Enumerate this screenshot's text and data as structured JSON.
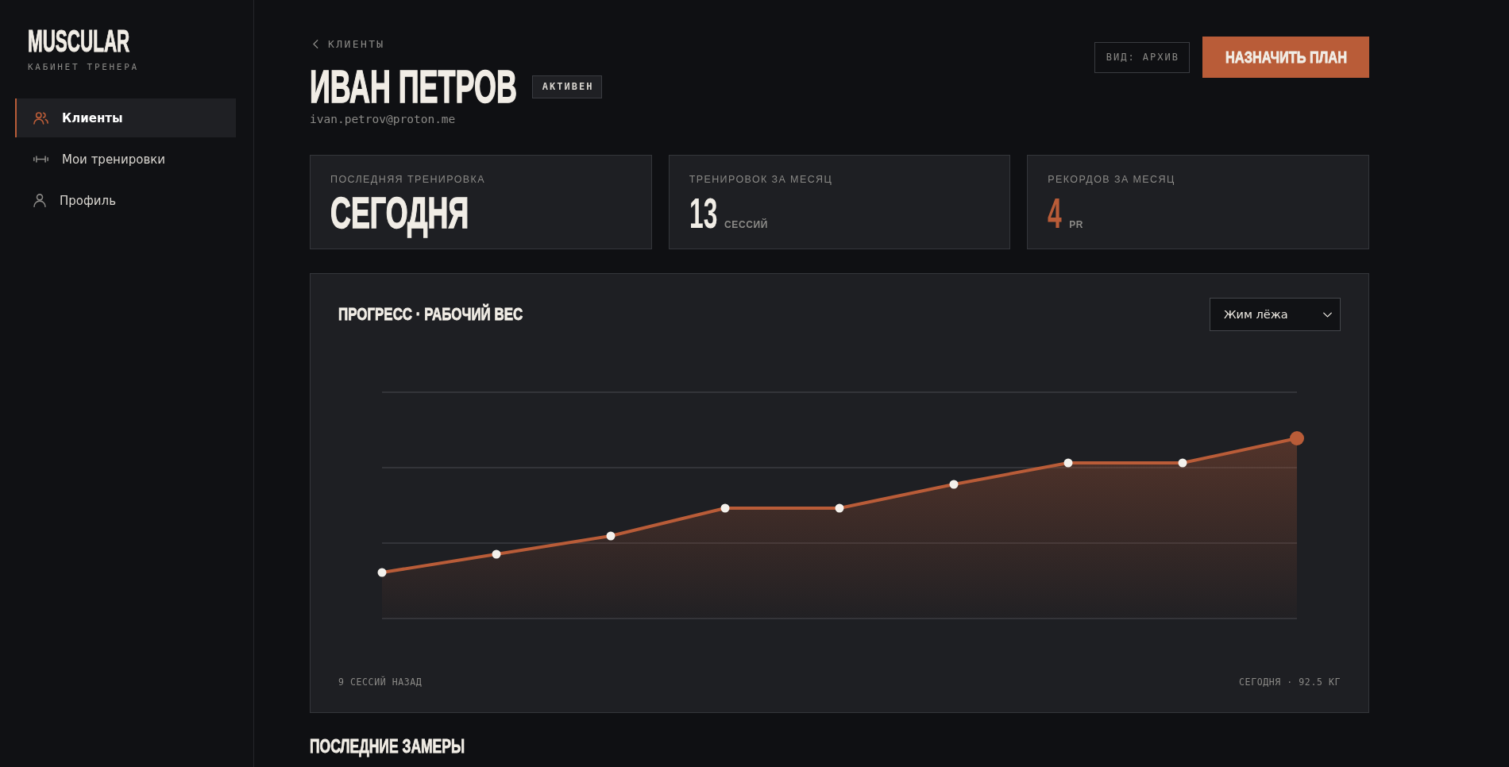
{
  "sidebar": {
    "logo": "MUSCULAR",
    "subtitle": "КАБИНЕТ ТРЕНЕРА",
    "items": [
      {
        "label": "Клиенты",
        "selected": true
      },
      {
        "label": "Мои тренировки",
        "selected": false
      },
      {
        "label": "Профиль",
        "selected": false
      }
    ]
  },
  "header": {
    "back_link": "КЛИЕНТЫ",
    "client_name": "ИВАН ПЕТРОВ",
    "status": "АКТИВЕН",
    "email": "ivan.petrov@proton.me",
    "view_button": "ВИД: АРХИВ",
    "primary_button": "НАЗНАЧИТЬ ПЛАН"
  },
  "stats": [
    {
      "kind": "word",
      "label": "ПОСЛЕДНЯЯ ТРЕНИРОВКА",
      "value": "СЕГОДНЯ",
      "accent": false
    },
    {
      "kind": "count",
      "label": "ТРЕНИРОВОК ЗА МЕСЯЦ",
      "value": "13",
      "unit": "СЕССИЙ",
      "accent": false
    },
    {
      "kind": "count",
      "label": "РЕКОРДОВ ЗА МЕСЯЦ",
      "value": "4",
      "unit": "PR",
      "accent": true
    }
  ],
  "progress": {
    "title": "ПРОГРЕСС · РАБОЧИЙ ВЕС",
    "exercise": "Жим лёжа",
    "start_label": "9 СЕССИЙ НАЗАД",
    "end_label": "СЕГОДНЯ · 92.5 КГ"
  },
  "section_title": "ПОСЛЕДНИЕ ЗАМЕРЫ"
}
